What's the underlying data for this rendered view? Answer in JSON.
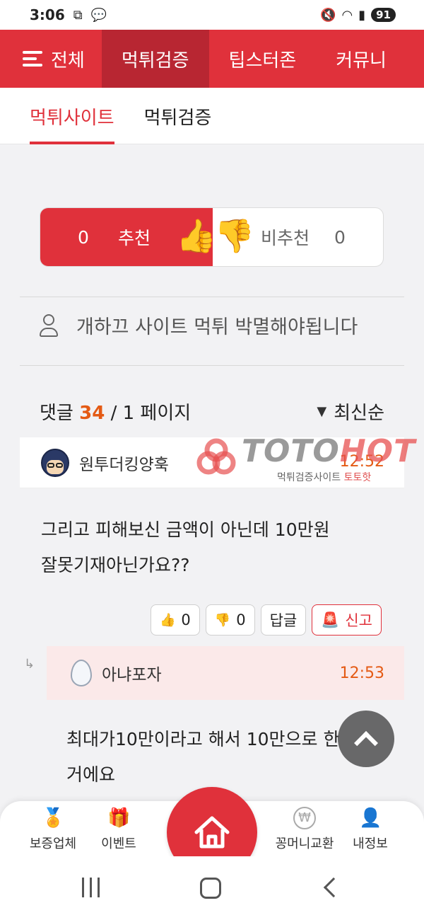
{
  "status_bar": {
    "time": "3:06",
    "battery": "91"
  },
  "nav": {
    "menu_label": "전체",
    "items": [
      {
        "label": "먹튀검증"
      },
      {
        "label": "팁스터존"
      },
      {
        "label": "커뮤니"
      }
    ]
  },
  "subtabs": [
    {
      "label": "먹튀사이트"
    },
    {
      "label": "먹튀검증"
    }
  ],
  "vote": {
    "recommend_count": "0",
    "recommend_label": "추천",
    "not_recommend_label": "비추천",
    "not_recommend_count": "0"
  },
  "post": {
    "author_line": "개하끄 사이트 먹튀 박멸해야됩니다"
  },
  "comments_header": {
    "label": "댓글",
    "count": "34",
    "page": "/ 1 페이지",
    "sort": "최신순"
  },
  "comment": {
    "author": "원투더킹양훅",
    "time": "12:52",
    "body_line1": "그리고 피해보신 금액이 아닌데 10만원",
    "body_line2": "잘못기재아닌가요??",
    "like_count": "0",
    "dislike_count": "0",
    "reply_label": "답글",
    "report_label": "신고"
  },
  "watermark": {
    "brand_main": "TOTO",
    "brand_accent": "HOT",
    "sub_main": "먹튀검증사이트",
    "sub_accent": "토토핫"
  },
  "reply": {
    "author": "아냐포자",
    "time": "12:53",
    "body_line1": "최대가10만이라고 해서 10만으로 한",
    "body_line2": "거에요"
  },
  "bottom_nav": {
    "items": [
      {
        "label": "보증업체",
        "icon": "medal-icon"
      },
      {
        "label": "이벤트",
        "icon": "gift-icon"
      },
      {
        "label": "꽁머니교환",
        "icon": "won-coin-icon"
      },
      {
        "label": "내정보",
        "icon": "user-icon"
      }
    ]
  },
  "colors": {
    "brand_red": "#e0313b",
    "accent_orange": "#e45a14",
    "reply_bg": "#fbe9e9"
  }
}
